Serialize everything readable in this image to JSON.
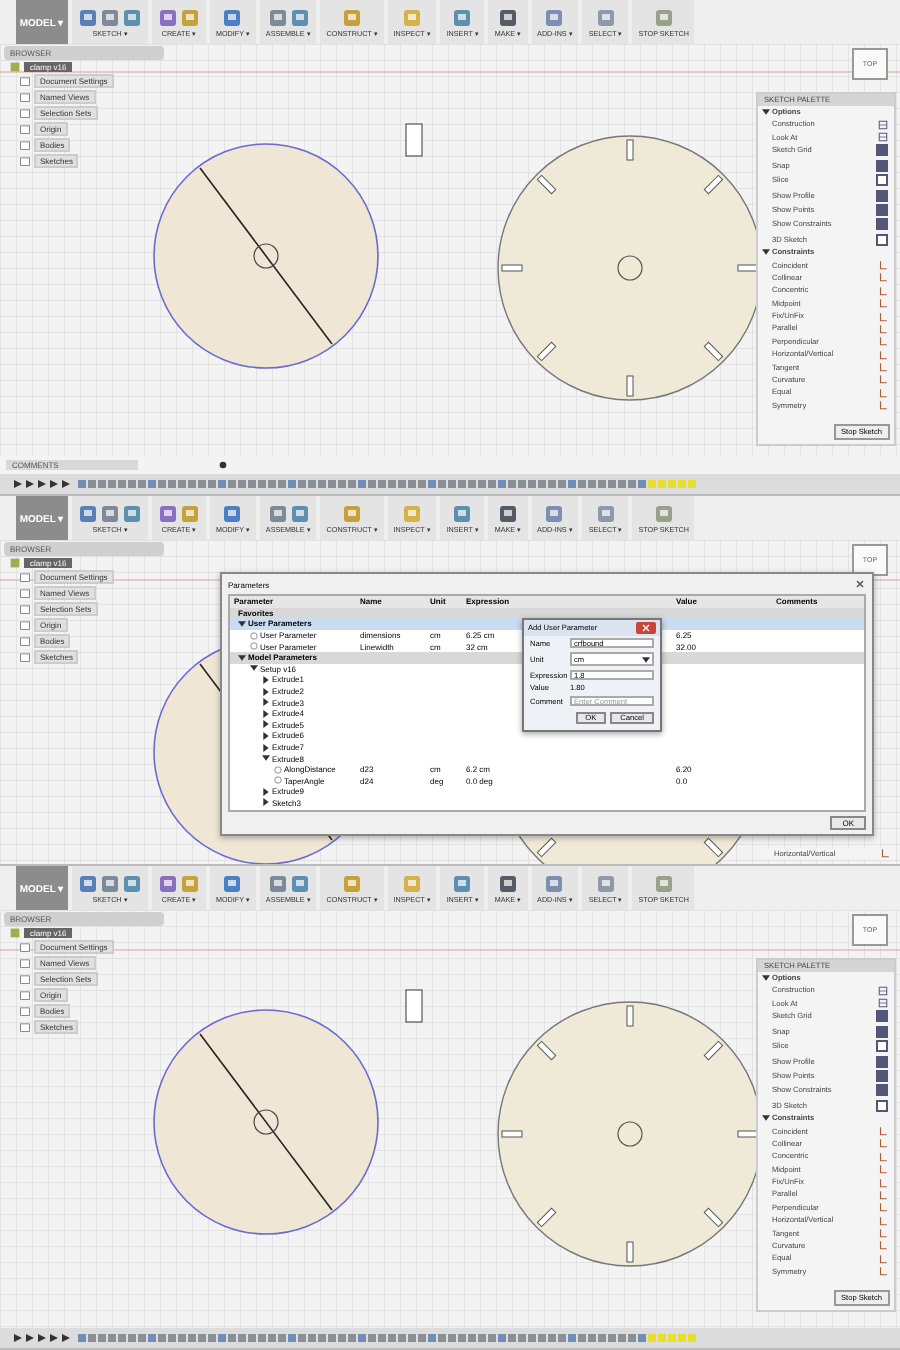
{
  "screens": [
    {
      "toolbar": {
        "workspace": "MODEL ▾",
        "groups": [
          {
            "label": "SKETCH ▾"
          },
          {
            "label": "CREATE ▾"
          },
          {
            "label": "MODIFY ▾"
          },
          {
            "label": "ASSEMBLE ▾"
          },
          {
            "label": "CONSTRUCT ▾"
          },
          {
            "label": "INSPECT ▾"
          },
          {
            "label": "INSERT ▾"
          },
          {
            "label": "MAKE ▾"
          },
          {
            "label": "ADD-INS ▾"
          },
          {
            "label": "SELECT ▾"
          },
          {
            "label": "STOP SKETCH"
          }
        ]
      },
      "view_cube": "TOP",
      "browser": {
        "title": "BROWSER",
        "root": "clamp v16",
        "items": [
          {
            "label": "Document Settings"
          },
          {
            "label": "Named Views"
          },
          {
            "label": "Selection Sets"
          },
          {
            "label": "Origin"
          },
          {
            "label": "Bodies"
          },
          {
            "label": "Sketches"
          }
        ]
      },
      "palette": {
        "title": "SKETCH PALETTE",
        "sections": [
          {
            "label": "Options",
            "expanded": true,
            "items": [
              {
                "kind": "option",
                "label": "Construction"
              },
              {
                "kind": "option",
                "label": "Look At"
              },
              {
                "kind": "option",
                "label": "Sketch Grid",
                "checked": true
              },
              {
                "kind": "option",
                "label": "Snap",
                "checked": true
              },
              {
                "kind": "option",
                "label": "Slice",
                "checked": false
              },
              {
                "kind": "option",
                "label": "Show Profile",
                "checked": true
              },
              {
                "kind": "option",
                "label": "Show Points",
                "checked": true
              },
              {
                "kind": "option",
                "label": "Show Constraints",
                "checked": true
              },
              {
                "kind": "option",
                "label": "3D Sketch",
                "checked": false
              }
            ]
          },
          {
            "label": "Constraints",
            "expanded": true,
            "items": [
              {
                "kind": "constraint",
                "label": "Coincident"
              },
              {
                "kind": "constraint",
                "label": "Collinear"
              },
              {
                "kind": "constraint",
                "label": "Concentric"
              },
              {
                "kind": "constraint",
                "label": "Midpoint"
              },
              {
                "kind": "constraint",
                "label": "Fix/UnFix"
              },
              {
                "kind": "constraint",
                "label": "Parallel"
              },
              {
                "kind": "constraint",
                "label": "Perpendicular"
              },
              {
                "kind": "constraint",
                "label": "Horizontal/Vertical"
              },
              {
                "kind": "constraint",
                "label": "Tangent"
              },
              {
                "kind": "constraint",
                "label": "Curvature"
              },
              {
                "kind": "constraint",
                "label": "Equal"
              },
              {
                "kind": "constraint",
                "label": "Symmetry"
              }
            ]
          }
        ],
        "button": "Stop Sketch"
      },
      "comments": "COMMENTS",
      "timeline": true
    },
    {
      "toolbar": {
        "workspace": "MODEL ▾",
        "groups": [
          {
            "label": "SKETCH ▾"
          },
          {
            "label": "CREATE ▾"
          },
          {
            "label": "MODIFY ▾"
          },
          {
            "label": "ASSEMBLE ▾"
          },
          {
            "label": "CONSTRUCT ▾"
          },
          {
            "label": "INSPECT ▾"
          },
          {
            "label": "INSERT ▾"
          },
          {
            "label": "MAKE ▾"
          },
          {
            "label": "ADD-INS ▾"
          },
          {
            "label": "SELECT ▾"
          },
          {
            "label": "STOP SKETCH"
          }
        ]
      },
      "view_cube": "TOP",
      "browser": {
        "title": "BROWSER",
        "root": "clamp v16",
        "items": [
          {
            "label": "Document Settings"
          },
          {
            "label": "Named Views"
          },
          {
            "label": "Selection Sets"
          },
          {
            "label": "Origin"
          },
          {
            "label": "Bodies"
          },
          {
            "label": "Sketches"
          }
        ]
      },
      "palette_fragment": [
        {
          "label": "Horizontal/Vertical"
        }
      ],
      "parameters": {
        "title": "Parameters",
        "columns": [
          "Parameter",
          "Name",
          "Unit",
          "Expression",
          "Value",
          "Comments"
        ],
        "rows": [
          {
            "kind": "section",
            "label": "Favorites",
            "selected": false
          },
          {
            "kind": "section",
            "label": "User Parameters",
            "selected": true,
            "expanded": true,
            "children": [
              {
                "kind": "param",
                "label": "User Parameter",
                "name": "dimensions",
                "unit": "cm",
                "expression": "6.25 cm",
                "value": "6.25"
              },
              {
                "kind": "param",
                "label": "User Parameter",
                "name": "Linewidth",
                "unit": "cm",
                "expression": "32 cm",
                "value": "32.00"
              }
            ]
          },
          {
            "kind": "section",
            "label": "Model Parameters",
            "selected": false,
            "expanded": true,
            "children": [
              {
                "kind": "node",
                "label": "Setup v16",
                "expanded": true,
                "children": [
                  {
                    "kind": "node",
                    "label": "Extrude1",
                    "expanded": false
                  },
                  {
                    "kind": "node",
                    "label": "Extrude2",
                    "expanded": false
                  },
                  {
                    "kind": "node",
                    "label": "Extrude3",
                    "expanded": false
                  },
                  {
                    "kind": "node",
                    "label": "Extrude4",
                    "expanded": false
                  },
                  {
                    "kind": "node",
                    "label": "Extrude5",
                    "expanded": false
                  },
                  {
                    "kind": "node",
                    "label": "Extrude6",
                    "expanded": false
                  },
                  {
                    "kind": "node",
                    "label": "Extrude7",
                    "expanded": false
                  },
                  {
                    "kind": "node",
                    "label": "Extrude8",
                    "expanded": true,
                    "children": [
                      {
                        "kind": "param",
                        "label": "AlongDistance",
                        "name": "d23",
                        "unit": "cm",
                        "expression": "6.2 cm",
                        "value": "6.20"
                      },
                      {
                        "kind": "param",
                        "label": "TaperAngle",
                        "name": "d24",
                        "unit": "deg",
                        "expression": "0.0 deg",
                        "value": "0.0"
                      }
                    ]
                  },
                  {
                    "kind": "node",
                    "label": "Extrude9",
                    "expanded": false
                  },
                  {
                    "kind": "node",
                    "label": "Sketch3",
                    "expanded": false
                  }
                ]
              }
            ]
          }
        ],
        "button": "OK",
        "add_dialog": {
          "title": "Add User Parameter",
          "fields": [
            {
              "kind": "input",
              "label": "Name",
              "value": "crfbound"
            },
            {
              "kind": "select",
              "label": "Unit",
              "value": "cm"
            },
            {
              "kind": "input",
              "label": "Expression",
              "value": "1.8"
            },
            {
              "kind": "text",
              "label": "Value",
              "value": "1.80"
            },
            {
              "kind": "input",
              "label": "Comment",
              "placeholder": "Enter Comment"
            }
          ],
          "buttons": [
            "OK",
            "Cancel"
          ]
        }
      }
    },
    {
      "toolbar": {
        "workspace": "MODEL ▾",
        "groups": [
          {
            "label": "SKETCH ▾"
          },
          {
            "label": "CREATE ▾"
          },
          {
            "label": "MODIFY ▾"
          },
          {
            "label": "ASSEMBLE ▾"
          },
          {
            "label": "CONSTRUCT ▾"
          },
          {
            "label": "INSPECT ▾"
          },
          {
            "label": "INSERT ▾"
          },
          {
            "label": "MAKE ▾"
          },
          {
            "label": "ADD-INS ▾"
          },
          {
            "label": "SELECT ▾"
          },
          {
            "label": "STOP SKETCH"
          }
        ]
      },
      "view_cube": "TOP",
      "browser": {
        "title": "BROWSER",
        "root": "clamp v16",
        "items": [
          {
            "label": "Document Settings"
          },
          {
            "label": "Named Views"
          },
          {
            "label": "Selection Sets"
          },
          {
            "label": "Origin"
          },
          {
            "label": "Bodies"
          },
          {
            "label": "Sketches"
          }
        ]
      },
      "palette": {
        "title": "SKETCH PALETTE",
        "sections": [
          {
            "label": "Options",
            "expanded": true,
            "items": [
              {
                "kind": "option",
                "label": "Construction"
              },
              {
                "kind": "option",
                "label": "Look At"
              },
              {
                "kind": "option",
                "label": "Sketch Grid",
                "checked": true
              },
              {
                "kind": "option",
                "label": "Snap",
                "checked": true
              },
              {
                "kind": "option",
                "label": "Slice",
                "checked": false
              },
              {
                "kind": "option",
                "label": "Show Profile",
                "checked": true
              },
              {
                "kind": "option",
                "label": "Show Points",
                "checked": true
              },
              {
                "kind": "option",
                "label": "Show Constraints",
                "checked": true
              },
              {
                "kind": "option",
                "label": "3D Sketch",
                "checked": false
              }
            ]
          },
          {
            "label": "Constraints",
            "expanded": true,
            "items": [
              {
                "kind": "constraint",
                "label": "Coincident"
              },
              {
                "kind": "constraint",
                "label": "Collinear"
              },
              {
                "kind": "constraint",
                "label": "Concentric"
              },
              {
                "kind": "constraint",
                "label": "Midpoint"
              },
              {
                "kind": "constraint",
                "label": "Fix/UnFix"
              },
              {
                "kind": "constraint",
                "label": "Parallel"
              },
              {
                "kind": "constraint",
                "label": "Perpendicular"
              },
              {
                "kind": "constraint",
                "label": "Horizontal/Vertical"
              },
              {
                "kind": "constraint",
                "label": "Tangent"
              },
              {
                "kind": "constraint",
                "label": "Curvature"
              },
              {
                "kind": "constraint",
                "label": "Equal"
              },
              {
                "kind": "constraint",
                "label": "Symmetry"
              }
            ]
          }
        ],
        "button": "Stop Sketch"
      },
      "timeline": true
    }
  ]
}
